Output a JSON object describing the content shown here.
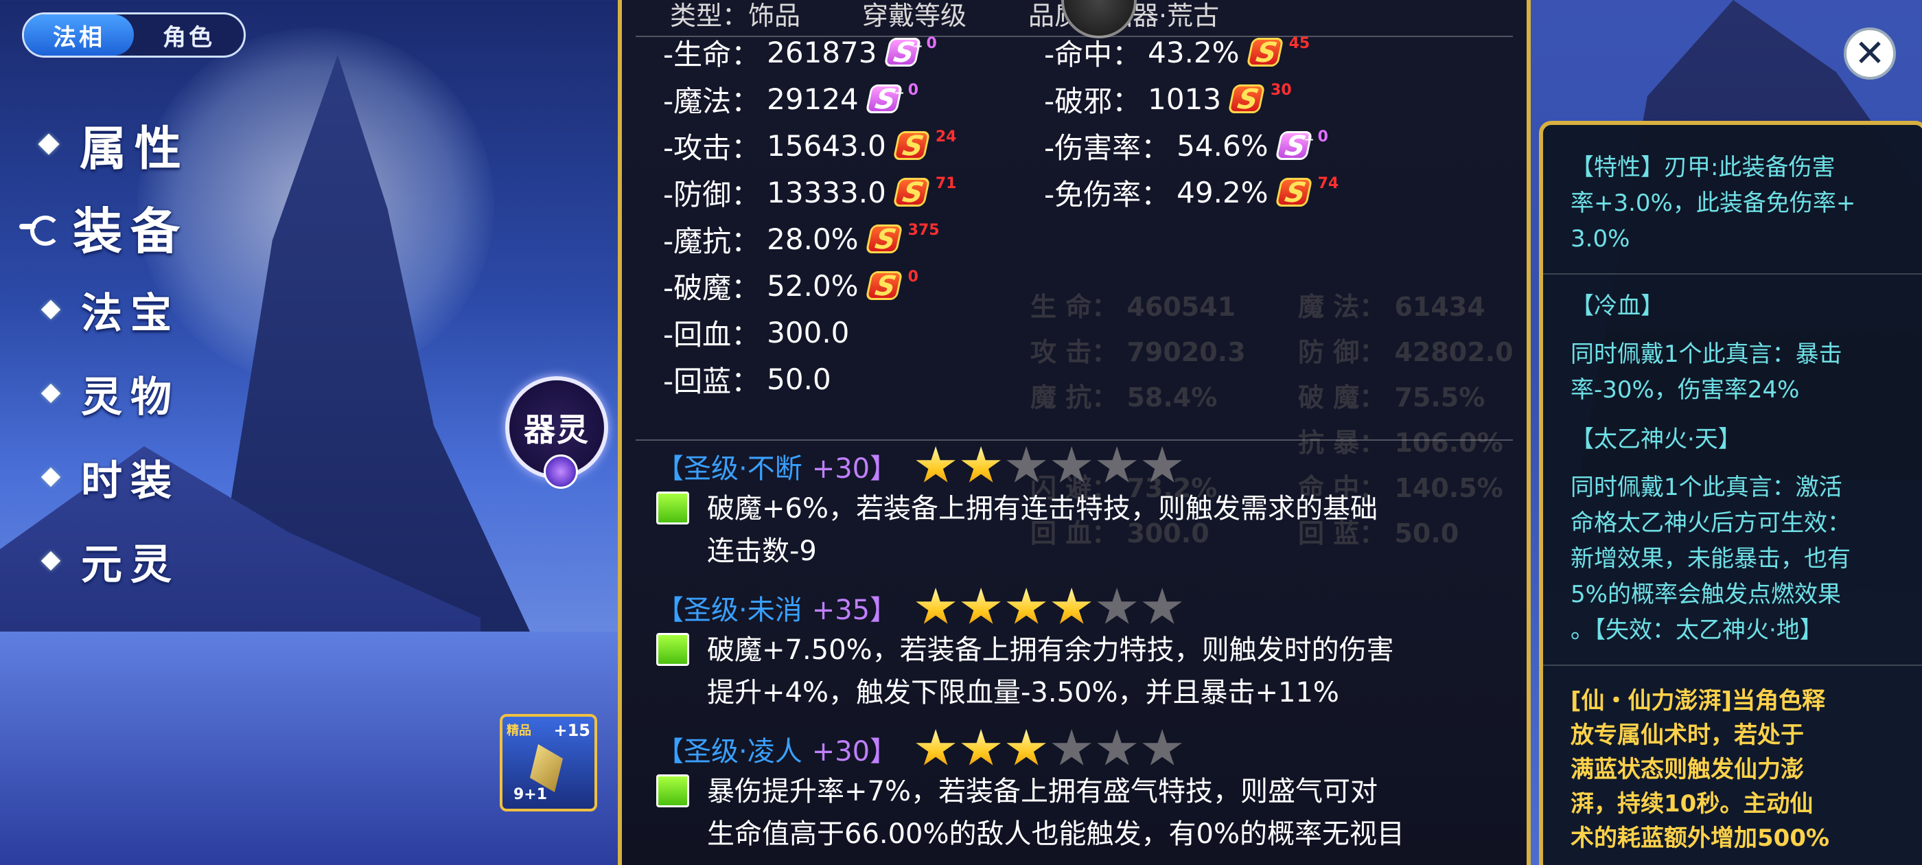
{
  "mode_toggle": {
    "active": "法相",
    "inactive": "角色"
  },
  "nav": {
    "main": [
      {
        "label": "属性"
      },
      {
        "label": "装备"
      }
    ],
    "sub": [
      {
        "label": "法宝"
      },
      {
        "label": "灵物"
      },
      {
        "label": "时装"
      },
      {
        "label": "元灵"
      }
    ]
  },
  "qiling_badge": {
    "label": "器灵"
  },
  "item_card": {
    "tag": "精品",
    "plus": "+15",
    "level": "9+1"
  },
  "tooltip": {
    "header": {
      "type": "类型：饰品",
      "wear_level": "穿戴等级",
      "quality": "品质：仙器·荒古"
    },
    "attrs_left": [
      {
        "k": "-生命：",
        "v": "261873",
        "icon": "purple",
        "n": "0"
      },
      {
        "k": "-魔法：",
        "v": "29124",
        "icon": "purple",
        "n": "0"
      },
      {
        "k": "-攻击：",
        "v": "15643.0",
        "icon": "red",
        "n": "24"
      },
      {
        "k": "-防御：",
        "v": "13333.0",
        "icon": "red",
        "n": "71"
      },
      {
        "k": "-魔抗：",
        "v": "28.0%",
        "icon": "red",
        "n": "375"
      },
      {
        "k": "-破魔：",
        "v": "52.0%",
        "icon": "red",
        "n": "0"
      },
      {
        "k": "-回血：",
        "v": "300.0"
      },
      {
        "k": "-回蓝：",
        "v": "50.0"
      }
    ],
    "attrs_right": [
      {
        "k": "-命中：",
        "v": "43.2%",
        "icon": "red",
        "n": "45"
      },
      {
        "k": "-破邪：",
        "v": "1013",
        "icon": "red",
        "n": "30"
      },
      {
        "k": "-伤害率：",
        "v": "54.6%",
        "icon": "purple",
        "n": "0"
      },
      {
        "k": "-免伤率：",
        "v": "49.2%",
        "icon": "red",
        "n": "74"
      }
    ],
    "underlay": {
      "rows": [
        {
          "l": "生 命： 460541",
          "r": "魔 法： 61434"
        },
        {
          "l": "攻 击： 79020.3",
          "r": "防 御： 42802.0"
        },
        {
          "l": "魔 抗： 58.4%",
          "r": "破 魔： 75.5%"
        },
        {
          "l": "",
          "r": "抗 暴： 106.0%"
        },
        {
          "l": "闪 避： 73.2%",
          "r": "命 中： 140.5%"
        },
        {
          "l": "回 血： 300.0",
          "r": "回 蓝： 50.0"
        }
      ]
    },
    "truths": [
      {
        "name": "【圣级·不断",
        "plus": "+30】",
        "stars": 2,
        "text": [
          "破魔+6%，若装备上拥有连击特技，则触发需求的基础",
          "连击数-9"
        ]
      },
      {
        "name": "【圣级·未消",
        "plus": "+35】",
        "stars": 4,
        "text": [
          "破魔+7.50%，若装备上拥有余力特技，则触发时的伤害",
          "提升+4%，触发下限血量-3.50%，并且暴击+11%"
        ]
      },
      {
        "name": "【圣级·凌人",
        "plus": "+30】",
        "stars": 3,
        "text": [
          "暴伤提升率+7%，若装备上拥有盛气特技，则盛气可对",
          "生命值高于66.00%的敌人也能触发，有0%的概率无视目"
        ]
      }
    ],
    "max_stars": 6
  },
  "close_button": {
    "label": "✕"
  },
  "right_panel": {
    "trait": [
      "【特性】刃甲:此装备伤害",
      "率+3.0%，此装备免伤率+",
      "3.0%"
    ],
    "cold_blood": {
      "title": "【冷血】",
      "text": [
        "同时佩戴1个此真言：暴击",
        "率-30%，伤害率24%"
      ]
    },
    "taiyi": {
      "title": "【太乙神火·天】",
      "text": [
        "同时佩戴1个此真言：激活",
        "命格太乙神火后方可生效：",
        "新增效果，未能暴击，也有",
        "5%的概率会触发点燃效果",
        "。【失效：太乙神火·地】"
      ]
    },
    "xianli": [
      "[仙・仙力澎湃]当角色释",
      "放专属仙术时，若处于",
      "满蓝状态则触发仙力澎",
      "湃，持续10秒。主动仙",
      "术的耗蓝额外增加500%"
    ]
  },
  "colors": {
    "gold_border": "#d8b040",
    "truth_blue": "#3aa0ff",
    "truth_plus": "#c080ff",
    "panel_cyan": "#6fe0e6",
    "panel_gold": "#ffd24a"
  }
}
